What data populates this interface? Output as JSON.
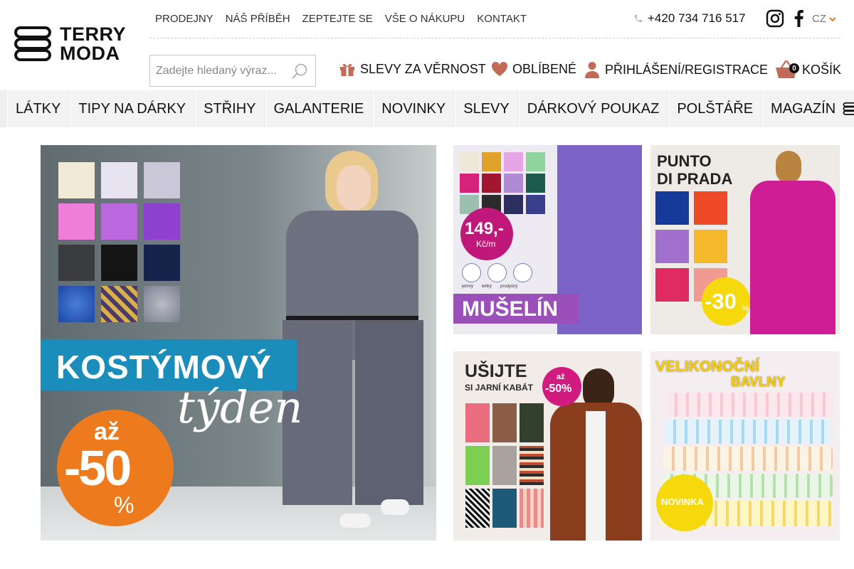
{
  "brand": {
    "name_line1": "TERRY",
    "name_line2": "MODA"
  },
  "topnav": {
    "links": [
      "PRODEJNY",
      "NÁŠ PŘÍBĚH",
      "ZEPTEJTE SE",
      "VŠE O NÁKUPU",
      "KONTAKT"
    ],
    "phone": "+420 734 716 517",
    "language": "CZ"
  },
  "search": {
    "placeholder": "Zadejte hledaný výraz..."
  },
  "utilities": {
    "loyalty": "SLEVY ZA VĚRNOST",
    "favorites": "OBLÍBENÉ",
    "login": "PŘIHLÁŠENÍ/REGISTRACE",
    "cart": "KOŠÍK",
    "cart_count": "0"
  },
  "categories": [
    "LÁTKY",
    "TIPY NA DÁRKY",
    "STŘIHY",
    "GALANTERIE",
    "NOVINKY",
    "SLEVY",
    "DÁRKOVÝ POUKAZ",
    "POLŠTÁŘE",
    "MAGAZÍN"
  ],
  "banners": {
    "main": {
      "title": "KOSTÝMOVÝ",
      "subtitle": "týden",
      "discount_prefix": "až",
      "discount": "-50",
      "percent": "%"
    },
    "muselin": {
      "price": "149,-",
      "unit": "Kč/m",
      "features": [
        "jemný",
        "lehký",
        "prodyšný"
      ],
      "title": "MUŠELÍN"
    },
    "punto": {
      "line1": "PUNTO",
      "line2": "DI PRADA",
      "discount": "-30",
      "percent": "%"
    },
    "coat": {
      "line1": "UŠIJTE",
      "line2": "SI JARNÍ KABÁT",
      "badge_prefix": "až",
      "badge": "-50%"
    },
    "easter": {
      "line1": "VELIKONOČNÍ",
      "line2": "BAVLNY",
      "badge": "NOVINKA"
    }
  },
  "colors": {
    "accent_orange": "#ee7a1e",
    "brand_blue": "#1a8dbb",
    "magenta": "#c0187a",
    "yellow": "#f5d90c",
    "purple_band": "#9b4fb8"
  }
}
